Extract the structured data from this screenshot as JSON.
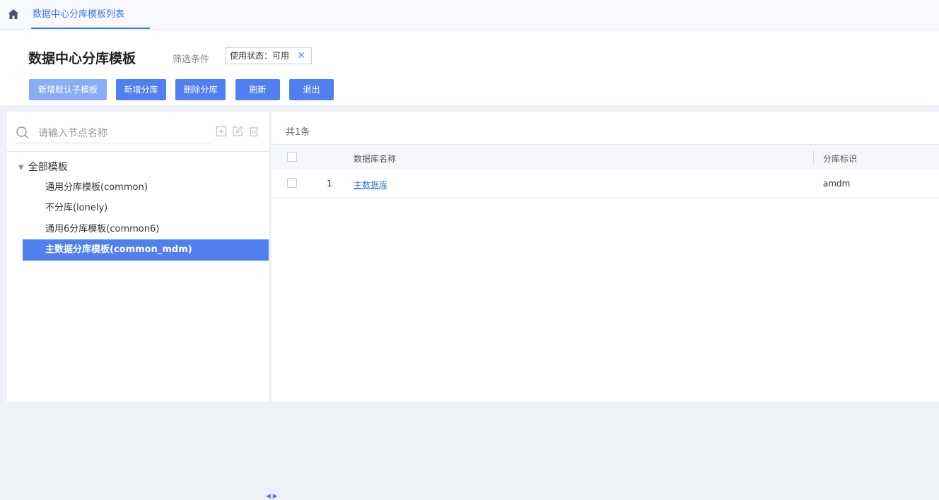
{
  "breadcrumb": {
    "tab_label": "数据中心分库模板列表"
  },
  "header": {
    "title": "数据中心分库模板",
    "filter_label": "筛选条件",
    "filter_tag": "使用状态：可用"
  },
  "toolbar": {
    "add_default_sub_template": "新增默认子模板",
    "add_shard": "新增分库",
    "delete_shard": "删除分库",
    "refresh": "刷新",
    "exit": "退出"
  },
  "tree": {
    "search_placeholder": "请输入节点名称",
    "root_label": "全部模板",
    "items": [
      {
        "label": "通用分库模板(common)"
      },
      {
        "label": "不分库(lonely)"
      },
      {
        "label": "通用6分库模板(common6)"
      },
      {
        "label": "主数据分库模板(common_mdm)"
      }
    ]
  },
  "table": {
    "count_text": "共1条",
    "columns": [
      "数据库名称",
      "分库标识"
    ],
    "rows": [
      {
        "index": "1",
        "name": "主数据库",
        "shard_id": "amdm"
      }
    ]
  },
  "colors": {
    "accent": "#4f7ff0",
    "link": "#3c7be8",
    "disabled_button": "#8aaef5"
  },
  "icons": [
    "home-icon",
    "search-icon",
    "add-node-icon",
    "edit-node-icon",
    "delete-node-icon",
    "collapse-arrow-icon"
  ]
}
